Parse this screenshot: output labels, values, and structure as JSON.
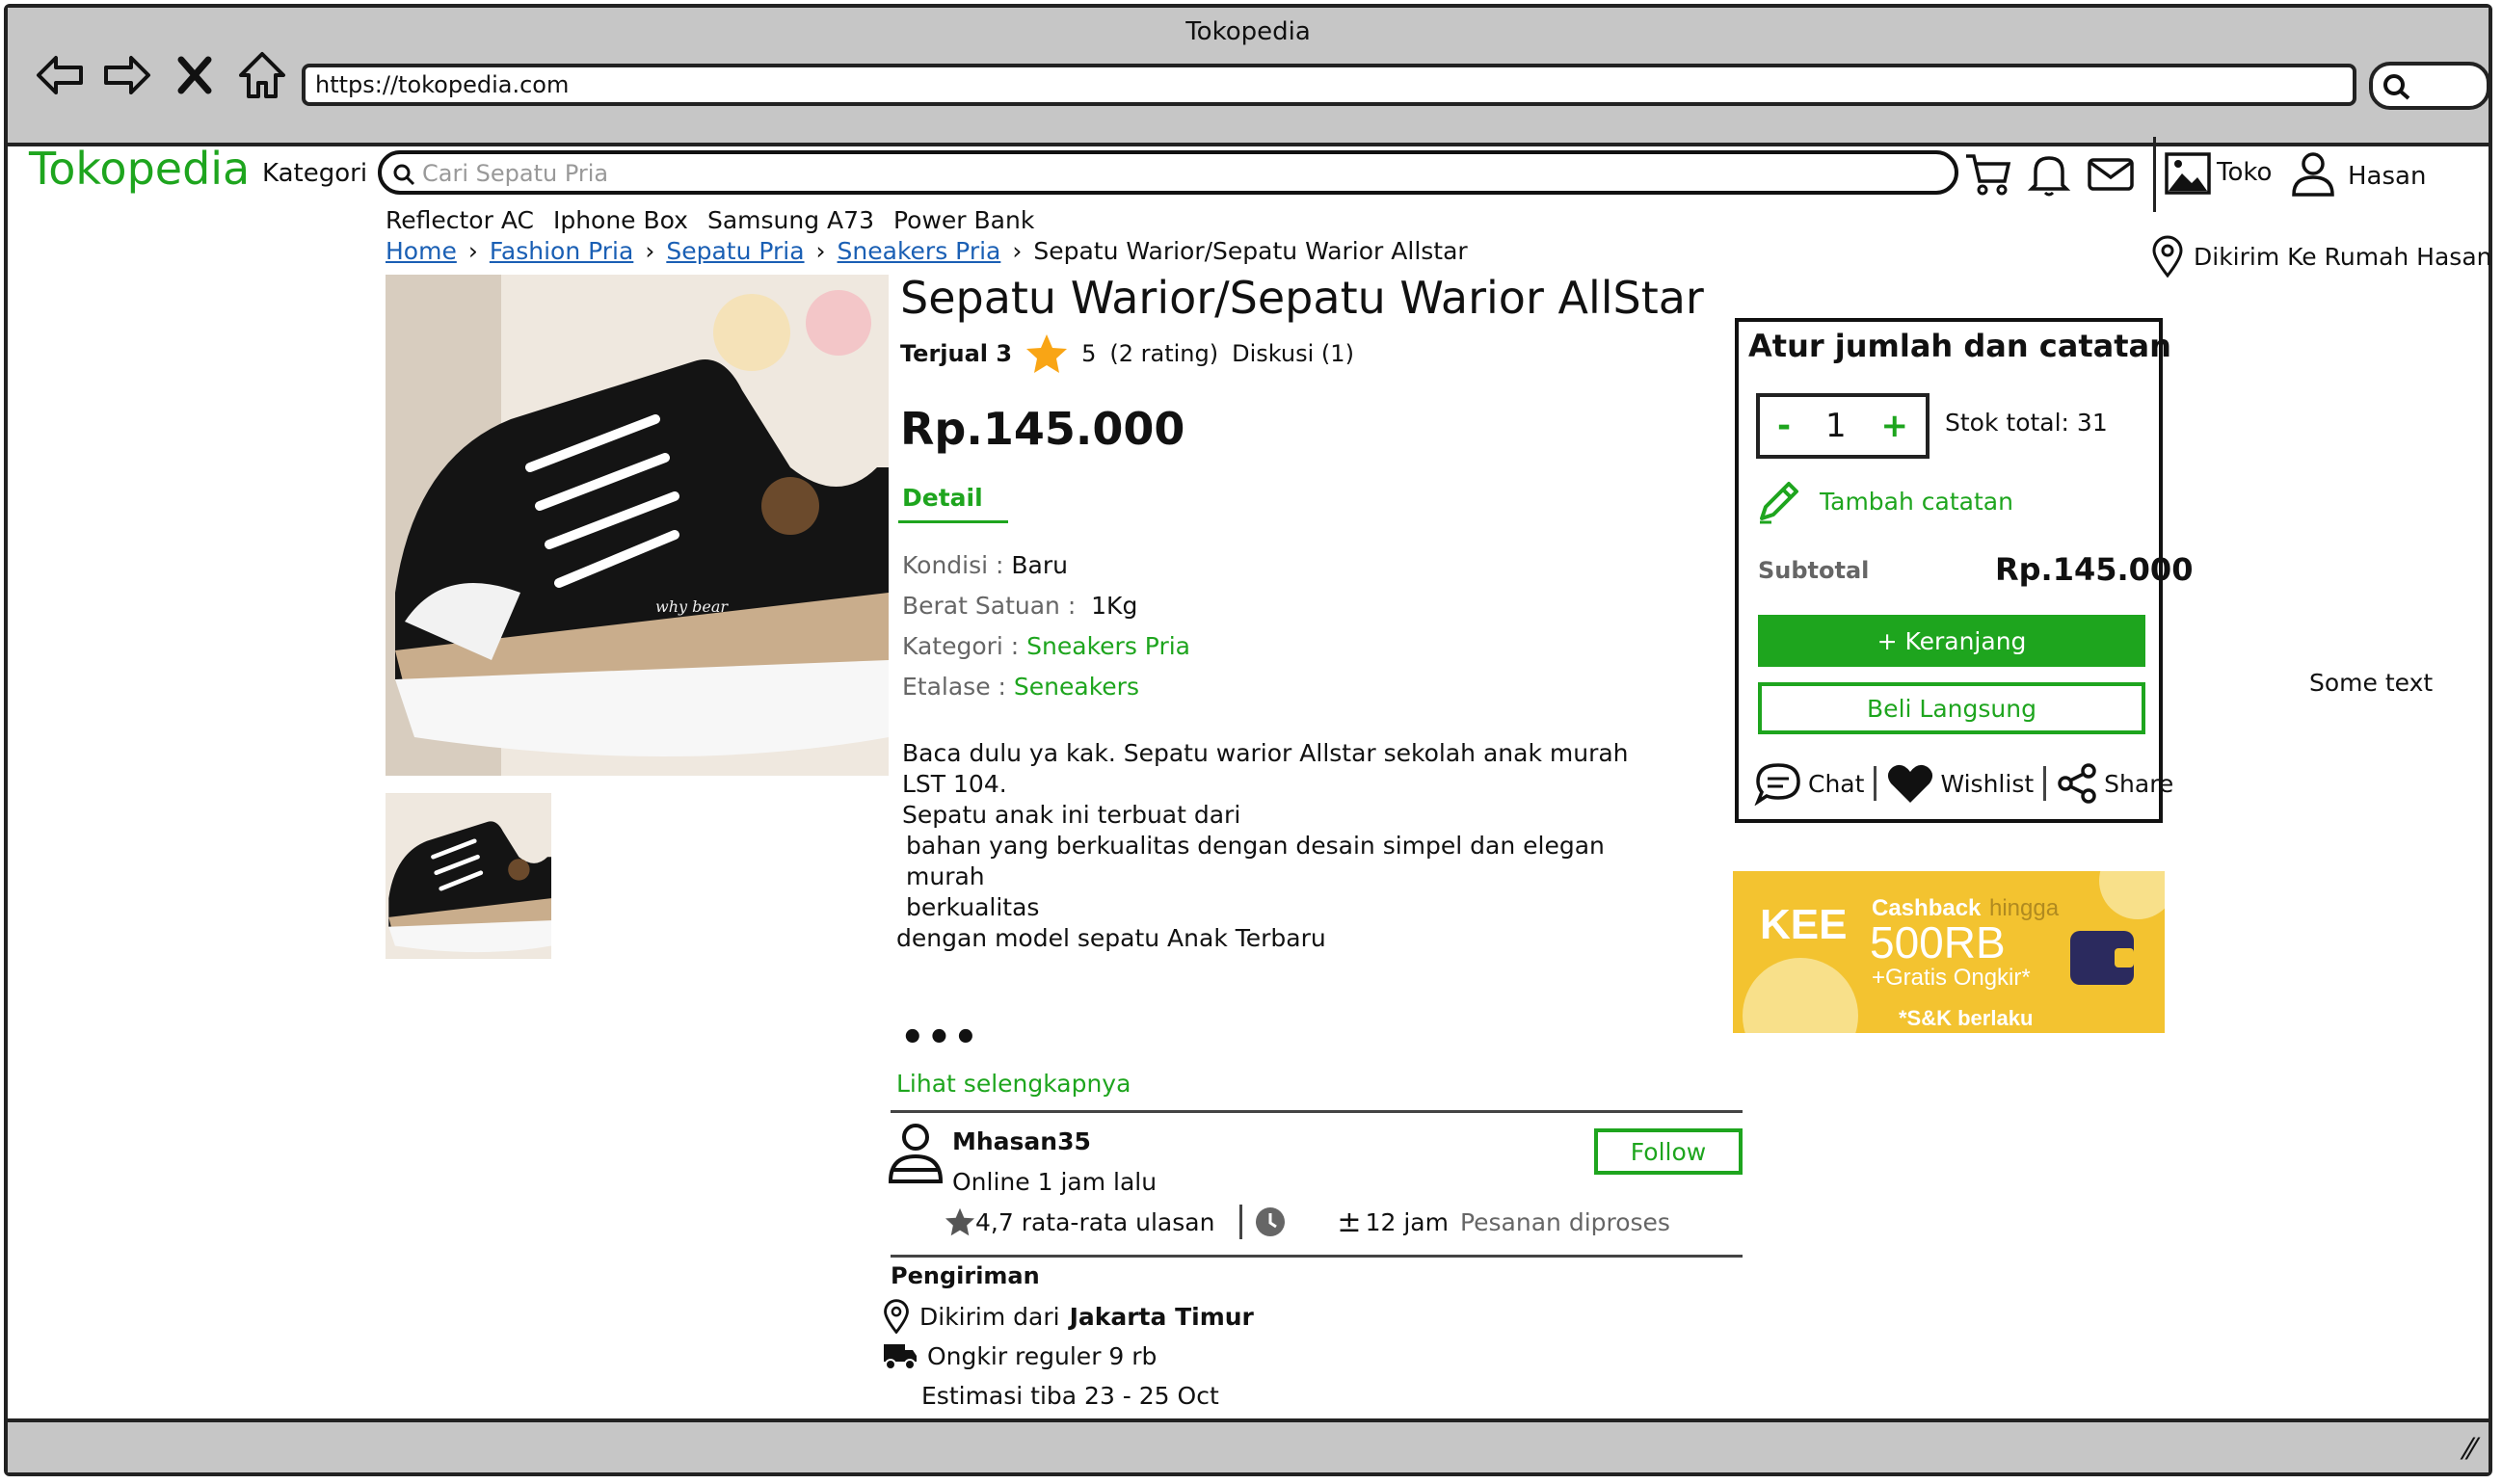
{
  "window": {
    "title": "Tokopedia",
    "url": "https://tokopedia.com"
  },
  "header": {
    "logo": "Tokopedia",
    "kategori": "Kategori",
    "search_placeholder": "Cari Sepatu Pria",
    "toko": "Toko",
    "user": "Hasan",
    "deliver_to": "Dikirim Ke Rumah Hasan"
  },
  "chips": [
    "Reflector AC",
    "Iphone Box",
    "Samsung A73",
    "Power Bank"
  ],
  "breadcrumb": {
    "home": "Home",
    "c1": "Fashion Pria",
    "c2": "Sepatu Pria",
    "c3": "Sneakers Pria",
    "current": "Sepatu Warior/Sepatu Warior Allstar"
  },
  "product": {
    "title": "Sepatu Warior/Sepatu Warior AllStar",
    "sold": "Terjual 3",
    "rating": "5",
    "rating_count": "(2 rating)",
    "diskusi": "Diskusi (1)",
    "price": "Rp.145.000",
    "detail_tab": "Detail",
    "kondisi_label": "Kondisi :",
    "kondisi": "Baru",
    "berat_label": "Berat Satuan :",
    "berat": "1Kg",
    "kategori_label": "Kategori :",
    "kategori": "Sneakers Pria",
    "etalase_label": "Etalase :",
    "etalase": "Seneakers",
    "desc1": "Baca dulu ya kak. Sepatu warior Allstar sekolah anak murah LST 104.",
    "desc2": "Sepatu anak ini terbuat dari",
    "desc3": "bahan yang berkualitas dengan desain simpel dan elegan murah",
    "desc4": "berkualitas",
    "desc5": "dengan model sepatu Anak Terbaru",
    "dots": "•••",
    "more": "Lihat selengkapnya",
    "shoe_brand": "why bear"
  },
  "seller": {
    "name": "Mhasan35",
    "online": "Online 1 jam lalu",
    "rating": "4,7 rata-rata ulasan",
    "process_time": "12 jam",
    "process_label": "Pesanan diproses",
    "follow": "Follow"
  },
  "shipping": {
    "title": "Pengiriman",
    "from_label": "Dikirim dari",
    "from": "Jakarta Timur",
    "ongkir": "Ongkir reguler 9 rb",
    "eta": "Estimasi tiba 23 - 25 Oct"
  },
  "cart": {
    "title": "Atur jumlah dan catatan",
    "minus": "-",
    "qty": "1",
    "plus": "+",
    "stock": "Stok total:  31",
    "note": "Tambah catatan",
    "subtotal_label": "Subtotal",
    "subtotal": "Rp.145.000",
    "add_cart": "+ Keranjang",
    "buy_now": "Beli Langsung",
    "chat": "Chat",
    "wishlist": "Wishlist",
    "share": "Share"
  },
  "promo": {
    "brand": "KEE",
    "cashback": "Cashback",
    "hingga": "hingga",
    "amount": "500RB",
    "ongkir": "+Gratis Ongkir*",
    "terms": "*S&K berlaku"
  },
  "side_text": "Some text",
  "colors": {
    "green": "#1ea51e",
    "link": "#1a5fb4",
    "chrome": "#c6c6c6",
    "banner": "#f3c330"
  }
}
